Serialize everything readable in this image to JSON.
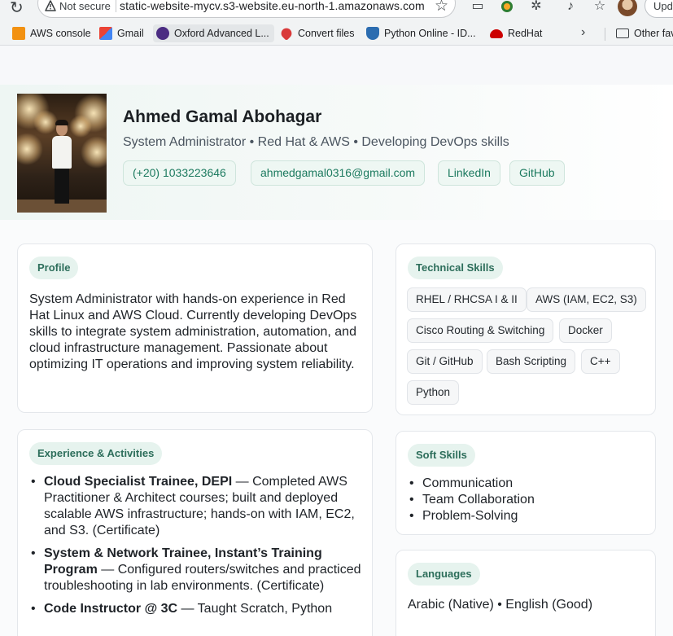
{
  "browser": {
    "security_label": "Not secure",
    "url": "static-website-mycv.s3-website.eu-north-1.amazonaws.com",
    "update_label": "Upda",
    "bookmarks": [
      {
        "label": "AWS console",
        "color": "#f29111"
      },
      {
        "label": "Gmail",
        "color": "#ea4335"
      },
      {
        "label": "Oxford Advanced L...",
        "color": "#4b2c82"
      },
      {
        "label": "Convert files",
        "color": "#d93a3a"
      },
      {
        "label": "Python Online  - ID...",
        "color": "#2b6cb0"
      },
      {
        "label": "RedHat",
        "color": "#cc0000"
      }
    ],
    "other_favorites_label": "Other fav"
  },
  "header": {
    "name": "Ahmed Gamal Abohagar",
    "tagline": "System Administrator • Red Hat & AWS • Developing DevOps skills",
    "contacts": {
      "phone": "(+20) 1033223646",
      "email": "ahmedgamal0316@gmail.com",
      "linkedin": "LinkedIn",
      "github": "GitHub"
    }
  },
  "profile": {
    "title": "Profile",
    "text": "System Administrator with hands-on experience in Red Hat Linux and AWS Cloud. Currently developing DevOps skills to integrate system administration, automation, and cloud infrastructure management. Passionate about optimizing IT operations and improving system reliability."
  },
  "skills": {
    "title": "Technical Skills",
    "items": [
      "RHEL / RHCSA I & II",
      "AWS (IAM, EC2, S3)",
      "Cisco Routing & Switching",
      "Docker",
      "Git / GitHub",
      "Bash Scripting",
      "C++",
      "Python"
    ]
  },
  "soft_skills": {
    "title": "Soft Skills",
    "items": [
      "Communication",
      "Team Collaboration",
      "Problem-Solving"
    ]
  },
  "experience": {
    "title": "Experience & Activities",
    "items": [
      {
        "role": "Cloud Specialist Trainee, DEPI",
        "desc": " — Completed AWS Practitioner & Architect courses; built and deployed scalable AWS infrastructure; hands-on with IAM, EC2, and S3. (Certificate)"
      },
      {
        "role": "System & Network Trainee, Instant’s Training Program",
        "desc": " — Configured routers/switches and practiced troubleshooting in lab environments. (Certificate)"
      },
      {
        "role": "Code Instructor @ 3C",
        "desc": " — Taught Scratch, Python"
      }
    ]
  },
  "languages": {
    "title": "Languages",
    "text": "Arabic (Native) • English (Good)"
  }
}
